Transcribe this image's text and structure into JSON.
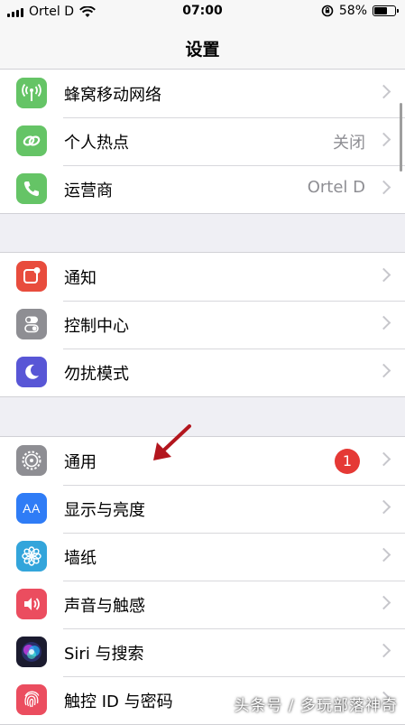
{
  "status": {
    "carrier": "Ortel D",
    "time": "07:00",
    "battery": "58%"
  },
  "nav": {
    "title": "设置"
  },
  "groups": [
    {
      "items": [
        {
          "label": "蜂窝移动网络",
          "value": "",
          "icon": "cellular-antenna-icon",
          "color": "#65c466"
        },
        {
          "label": "个人热点",
          "value": "关闭",
          "icon": "hotspot-link-icon",
          "color": "#65c466"
        },
        {
          "label": "运营商",
          "value": "Ortel D",
          "icon": "phone-icon",
          "color": "#65c466"
        }
      ]
    },
    {
      "items": [
        {
          "label": "通知",
          "value": "",
          "icon": "notification-icon",
          "color": "#e84c3d"
        },
        {
          "label": "控制中心",
          "value": "",
          "icon": "toggle-switches-icon",
          "color": "#8e8e93"
        },
        {
          "label": "勿扰模式",
          "value": "",
          "icon": "moon-icon",
          "color": "#5856d6"
        }
      ]
    },
    {
      "items": [
        {
          "label": "通用",
          "value": "",
          "badge": "1",
          "icon": "gear-icon",
          "color": "#8e8e93"
        },
        {
          "label": "显示与亮度",
          "value": "",
          "icon": "text-size-icon",
          "color": "#2f7cf6",
          "glyph": "AA"
        },
        {
          "label": "墙纸",
          "value": "",
          "icon": "flower-icon",
          "color": "#33a5db"
        },
        {
          "label": "声音与触感",
          "value": "",
          "icon": "speaker-icon",
          "color": "#eb4d5f"
        },
        {
          "label": "Siri 与搜索",
          "value": "",
          "icon": "siri-icon",
          "color": "#1b1b2f"
        },
        {
          "label": "触控 ID 与密码",
          "value": "",
          "icon": "fingerprint-icon",
          "color": "#eb4d5f"
        }
      ]
    }
  ],
  "watermark": "头条号 / 多玩部落神奇"
}
